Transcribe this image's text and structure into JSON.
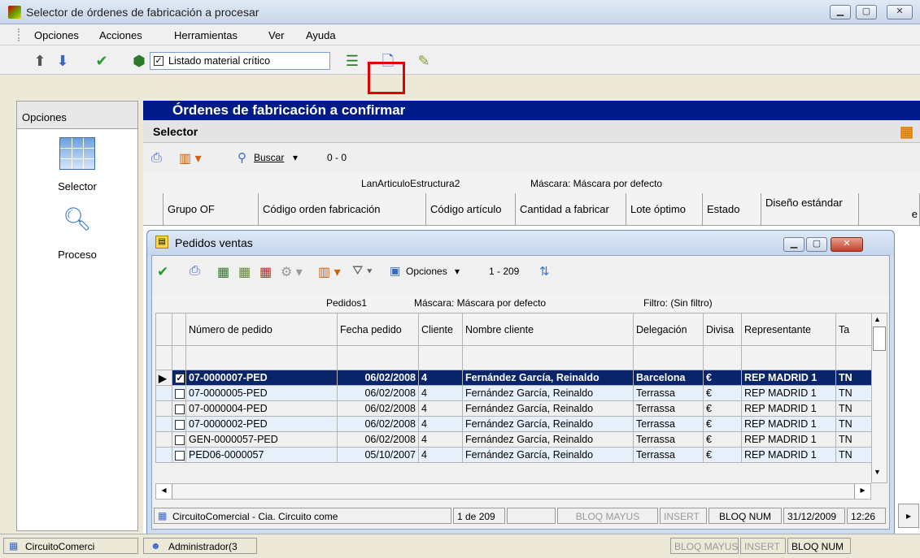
{
  "window": {
    "title": "Selector de órdenes de fabricación a procesar"
  },
  "menu": [
    "Opciones",
    "Acciones",
    "Herramientas",
    "Ver",
    "Ayuda"
  ],
  "toolbar": {
    "combo_label": "Listado material crítico",
    "combo_checked": true
  },
  "sidebar": {
    "header": "Opciones",
    "items": [
      {
        "label": "Selector",
        "icon": "grid-icon"
      },
      {
        "label": "Proceso",
        "icon": "process-search-icon"
      }
    ]
  },
  "main": {
    "band_title": "Órdenes de fabricación a confirmar",
    "selector_label": "Selector",
    "search_label": "Buscar",
    "count": "0 - 0",
    "source": "LanArticuloEstructura2",
    "mask": "Máscara: Máscara por defecto",
    "columns": [
      "Grupo OF",
      "Código orden fabricación",
      "Código artículo",
      "Cantidad a fabricar",
      "Lote óptimo",
      "Estado",
      "Diseño estándar",
      "e"
    ]
  },
  "child": {
    "title": "Pedidos ventas",
    "options_label": "Opciones",
    "count": "1 - 209",
    "source": "Pedidos1",
    "mask": "Máscara: Máscara por defecto",
    "filter": "Filtro: (Sin filtro)",
    "columns": [
      "Número de pedido",
      "Fecha pedido",
      "Cliente",
      "Nombre cliente",
      "Delegación",
      "Divisa",
      "Representante",
      "Ta"
    ],
    "rows": [
      {
        "checked": true,
        "pedido": "07-0000007-PED",
        "fecha": "06/02/2008",
        "cliente": "4",
        "nombre": "Fernández García, Reinaldo",
        "delegacion": "Barcelona",
        "divisa": "€",
        "rep": "REP MADRID 1",
        "ta": "TN"
      },
      {
        "checked": false,
        "pedido": "07-0000005-PED",
        "fecha": "06/02/2008",
        "cliente": "4",
        "nombre": "Fernández García, Reinaldo",
        "delegacion": "Terrassa",
        "divisa": "€",
        "rep": "REP MADRID 1",
        "ta": "TN"
      },
      {
        "checked": false,
        "pedido": "07-0000004-PED",
        "fecha": "06/02/2008",
        "cliente": "4",
        "nombre": "Fernández García, Reinaldo",
        "delegacion": "Terrassa",
        "divisa": "€",
        "rep": "REP MADRID 1",
        "ta": "TN"
      },
      {
        "checked": false,
        "pedido": "07-0000002-PED",
        "fecha": "06/02/2008",
        "cliente": "4",
        "nombre": "Fernández García, Reinaldo",
        "delegacion": "Terrassa",
        "divisa": "€",
        "rep": "REP MADRID 1",
        "ta": "TN"
      },
      {
        "checked": false,
        "pedido": "GEN-0000057-PED",
        "fecha": "06/02/2008",
        "cliente": "4",
        "nombre": "Fernández García, Reinaldo",
        "delegacion": "Terrassa",
        "divisa": "€",
        "rep": "REP MADRID 1",
        "ta": "TN"
      },
      {
        "checked": false,
        "pedido": "PED06-0000057",
        "fecha": "05/10/2007",
        "cliente": "4",
        "nombre": "Fernández García, Reinaldo",
        "delegacion": "Terrassa",
        "divisa": "€",
        "rep": "REP MADRID 1",
        "ta": "TN"
      }
    ],
    "status": {
      "company": "CircuitoComercial - Cia. Circuito come",
      "record": "1 de 209",
      "caps": "BLOQ MAYUS",
      "insert": "INSERT",
      "num": "BLOQ NUM",
      "date": "31/12/2009",
      "time": "12:26"
    }
  },
  "statusbar": {
    "company": "CircuitoComerci",
    "user": "Administrador(3",
    "caps": "BLOQ MAYUS",
    "insert": "INSERT",
    "num": "BLOQ NUM"
  }
}
